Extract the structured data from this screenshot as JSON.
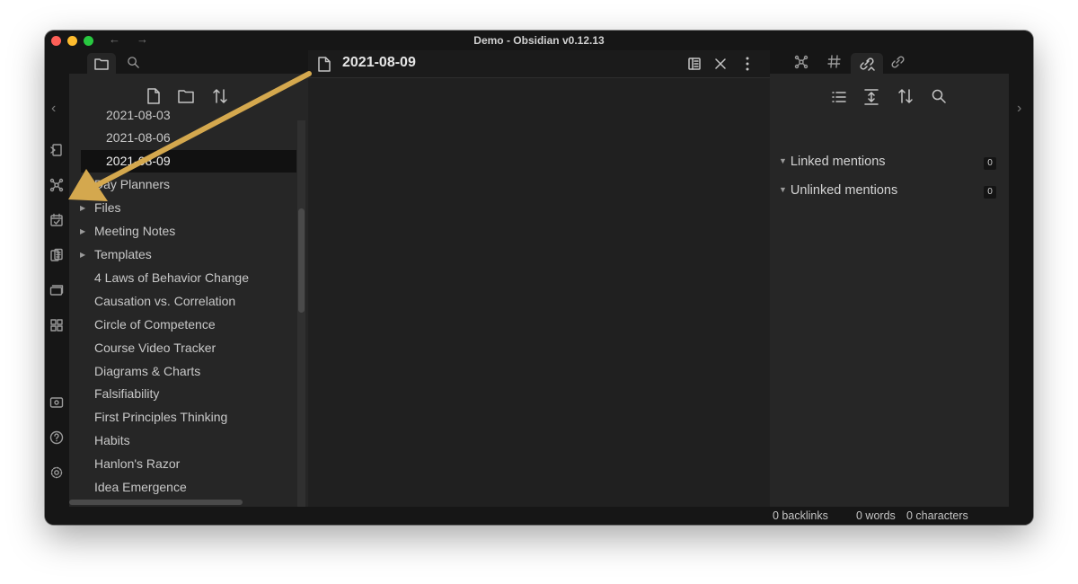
{
  "window": {
    "title": "Demo - Obsidian v0.12.13"
  },
  "editor": {
    "title": "2021-08-09"
  },
  "file_tree": {
    "items": [
      {
        "label": "2021-08-03",
        "indent": 1,
        "folder": false,
        "active": false
      },
      {
        "label": "2021-08-06",
        "indent": 1,
        "folder": false,
        "active": false
      },
      {
        "label": "2021-08-09",
        "indent": 1,
        "folder": false,
        "active": true
      },
      {
        "label": "Day Planners",
        "indent": 0,
        "folder": false,
        "active": false
      },
      {
        "label": "Files",
        "indent": 0,
        "folder": true,
        "active": false
      },
      {
        "label": "Meeting Notes",
        "indent": 0,
        "folder": true,
        "active": false
      },
      {
        "label": "Templates",
        "indent": 0,
        "folder": true,
        "active": false
      },
      {
        "label": "4 Laws of Behavior Change",
        "indent": 0,
        "folder": false,
        "active": false
      },
      {
        "label": "Causation vs. Correlation",
        "indent": 0,
        "folder": false,
        "active": false
      },
      {
        "label": "Circle of Competence",
        "indent": 0,
        "folder": false,
        "active": false
      },
      {
        "label": "Course Video Tracker",
        "indent": 0,
        "folder": false,
        "active": false
      },
      {
        "label": "Diagrams & Charts",
        "indent": 0,
        "folder": false,
        "active": false
      },
      {
        "label": "Falsifiability",
        "indent": 0,
        "folder": false,
        "active": false
      },
      {
        "label": "First Principles Thinking",
        "indent": 0,
        "folder": false,
        "active": false
      },
      {
        "label": "Habits",
        "indent": 0,
        "folder": false,
        "active": false
      },
      {
        "label": "Hanlon's Razor",
        "indent": 0,
        "folder": false,
        "active": false
      },
      {
        "label": "Idea Emergence",
        "indent": 0,
        "folder": false,
        "active": false
      }
    ]
  },
  "backlinks": {
    "linked": {
      "label": "Linked mentions",
      "count": "0"
    },
    "unlinked": {
      "label": "Unlinked mentions",
      "count": "0"
    }
  },
  "status": {
    "backlinks": "0 backlinks",
    "words": "0 words",
    "characters": "0 characters"
  },
  "colors": {
    "annotation_arrow": "#d4a84e",
    "background": "#202020",
    "panel": "#262626"
  },
  "icons": {
    "ribbon": [
      "open-switcher-icon",
      "graph-view-icon",
      "daily-note-icon",
      "templates-icon",
      "slides-icon",
      "command-palette-icon",
      "vault-icon",
      "help-icon",
      "settings-icon"
    ]
  }
}
